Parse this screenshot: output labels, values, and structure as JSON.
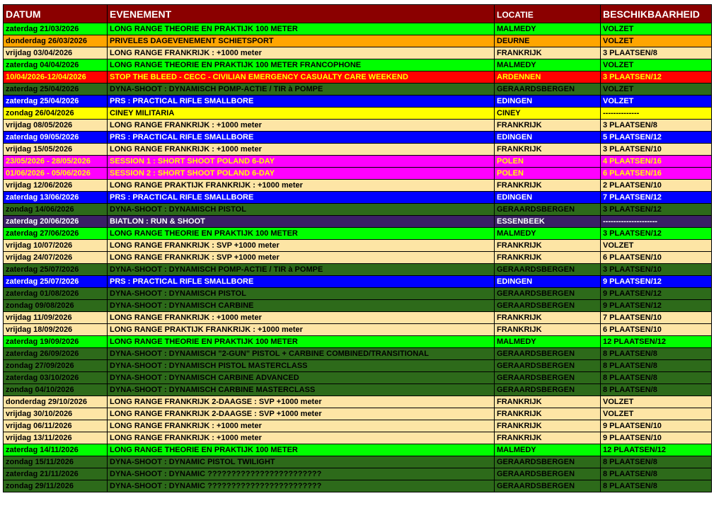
{
  "headers": {
    "datum": "DATUM",
    "evenement": "EVENEMENT",
    "locatie": "LOCATIE",
    "beschikbaarheid": "BESCHIKBAARHEID"
  },
  "colors": {
    "header": "#8b0000",
    "green": "#00ff00",
    "orange": "#ffa500",
    "beige": "#fde5a5",
    "red": "#ff0000",
    "darkgreen": "#2d6a1a",
    "blue": "#0000ff",
    "yellow": "#ffff00",
    "magenta": "#ff00ff",
    "purple": "#3a1f66"
  },
  "rows": [
    {
      "date": "zaterdag 21/03/2026",
      "event": "LONG RANGE THEORIE EN PRAKTIJK 100 METER",
      "location": "MALMEDY",
      "availability": "VOLZET",
      "style": "greenbright"
    },
    {
      "date": "donderdag 26/03/2026",
      "event": "PRIVELES DAGEVENEMENT SCHIETSPORT",
      "location": "DEURNE",
      "availability": "VOLZET",
      "style": "orange"
    },
    {
      "date": "vrijdag 03/04/2026",
      "event": "LONG RANGE FRANKRIJK : +1000 meter",
      "location": "FRANKRIJK",
      "availability": "3 PLAATSEN/8",
      "style": "beige"
    },
    {
      "date": "zaterdag 04/04/2026",
      "event": "LONG RANGE THEORIE EN PRAKTIJK 100 METER FRANCOPHONE",
      "location": "MALMEDY",
      "availability": "VOLZET",
      "style": "greenbright"
    },
    {
      "date": "10/04/2026-12/04/2026",
      "event": "STOP THE BLEED - CECC - CIVILIAN EMERGENCY CASUALTY CARE WEEKEND",
      "location": "ARDENNEN",
      "availability": "3 PLAATSEN/12",
      "style": "red"
    },
    {
      "date": "zaterdag 25/04/2026",
      "event": "DYNA-SHOOT : DYNAMISCH POMP-ACTIE / TIR à POMPE",
      "location": "GERAARDSBERGEN",
      "availability": "VOLZET",
      "style": "darkgreen"
    },
    {
      "date": "zaterdag 25/04/2026",
      "event": "PRS : PRACTICAL RIFLE SMALLBORE",
      "location": "EDINGEN",
      "availability": "VOLZET",
      "style": "blue"
    },
    {
      "date": "zondag 26/04/2026",
      "event": "CINEY MILITARIA",
      "location": "CINEY",
      "availability": "--------------",
      "style": "yellow"
    },
    {
      "date": "vrijdag 08/05/2026",
      "event": "LONG RANGE FRANKRIJK : +1000 meter",
      "location": "FRANKRIJK",
      "availability": "3 PLAATSEN/8",
      "style": "beige"
    },
    {
      "date": "zaterdag 09/05/2026",
      "event": "PRS : PRACTICAL RIFLE SMALLBORE",
      "location": "EDINGEN",
      "availability": "5 PLAATSEN/12",
      "style": "blue"
    },
    {
      "date": "vrijdag 15/05/2026",
      "event": "LONG RANGE FRANKRIJK : +1000 meter",
      "location": "FRANKRIJK",
      "availability": "3 PLAATSEN/10",
      "style": "beige"
    },
    {
      "date": "23/05/2026 - 28/05/2026",
      "event": "SESSION 1 : SHORT SHOOT POLAND 6-DAY",
      "location": "POLEN",
      "availability": "4 PLAATSEN/16",
      "style": "magenta"
    },
    {
      "date": "01/06/2026 - 05/06/2026",
      "event": "SESSION 2 : SHORT SHOOT POLAND 6-DAY",
      "location": "POLEN",
      "availability": "6 PLAATSEN/16",
      "style": "magenta"
    },
    {
      "date": "vrijdag 12/06/2026",
      "event": "LONG RANGE PRAKTIJK FRANKRIJK : +1000 meter",
      "location": "FRANKRIJK",
      "availability": "2 PLAATSEN/10",
      "style": "beige"
    },
    {
      "date": "zaterdag 13/06/2026",
      "event": "PRS : PRACTICAL RIFLE SMALLBORE",
      "location": "EDINGEN",
      "availability": "7 PLAATSEN/12",
      "style": "blue"
    },
    {
      "date": "zondag 14/06/2026",
      "event": "DYNA-SHOOT : DYNAMISCH PISTOL",
      "location": "GERAARDSBERGEN",
      "availability": "3 PLAATSEN/12",
      "style": "darkgreen"
    },
    {
      "date": "zaterdag 20/06/2026",
      "event": "BIATLON : RUN & SHOOT",
      "location": "ESSENBEEK",
      "availability": "---------------------",
      "style": "purple"
    },
    {
      "date": "zaterdag 27/06/2026",
      "event": "LONG RANGE THEORIE EN PRAKTIJK 100 METER",
      "location": "MALMEDY",
      "availability": "3 PLAATSEN/12",
      "style": "greenbright"
    },
    {
      "date": "vrijdag 10/07/2026",
      "event": "LONG RANGE  FRANKRIJK : SVP +1000 meter",
      "location": "FRANKRIJK",
      "availability": "VOLZET",
      "style": "beige"
    },
    {
      "date": "vrijdag 24/07/2026",
      "event": "LONG RANGE FRANKRIJK : SVP +1000 meter",
      "location": "FRANKRIJK",
      "availability": "6 PLAATSEN/10",
      "style": "beige"
    },
    {
      "date": "zaterdag 25/07/2026",
      "event": "DYNA-SHOOT : DYNAMISCH POMP-ACTIE / TIR à POMPE",
      "location": "GERAARDSBERGEN",
      "availability": "3 PLAATSEN/10",
      "style": "darkgreen"
    },
    {
      "date": "zaterdag 25/07/2026",
      "event": "PRS : PRACTICAL RIFLE SMALLBORE",
      "location": "EDINGEN",
      "availability": "9 PLAATSEN/12",
      "style": "blue"
    },
    {
      "date": "zaterdag 01/08/2026",
      "event": "DYNA-SHOOT : DYNAMISCH PISTOL",
      "location": "GERAARDSBERGEN",
      "availability": "9 PLAATSEN/12",
      "style": "darkgreen"
    },
    {
      "date": "zondag 09/08/2026",
      "event": "DYNA-SHOOT : DYNAMISCH CARBINE",
      "location": "GERAARDSBERGEN",
      "availability": "9 PLAATSEN/12",
      "style": "darkgreen"
    },
    {
      "date": "vrijdag 11/09/2026",
      "event": "LONG RANGE FRANKRIJK : +1000 meter",
      "location": "FRANKRIJK",
      "availability": "7 PLAATSEN/10",
      "style": "beige"
    },
    {
      "date": "vrijdag 18/09/2026",
      "event": "LONG RANGE PRAKTIJK FRANKRIJK : +1000 meter",
      "location": "FRANKRIJK",
      "availability": "6 PLAATSEN/10",
      "style": "beige"
    },
    {
      "date": "zaterdag 19/09/2026",
      "event": "LONG RANGE THEORIE EN PRAKTIJK 100 METER",
      "location": "MALMEDY",
      "availability": "12 PLAATSEN/12",
      "style": "greenbright"
    },
    {
      "date": "zaterdag 26/09/2026",
      "event": "DYNA-SHOOT : DYNAMISCH \"2-GUN\" PISTOL + CARBINE COMBINED/TRANSITIONAL",
      "location": "GERAARDSBERGEN",
      "availability": "8 PLAATSEN/8",
      "style": "darkgreen"
    },
    {
      "date": "zondag 27/09/2026",
      "event": "DYNA-SHOOT : DYNAMISCH PISTOL MASTERCLASS",
      "location": "GERAARDSBERGEN",
      "availability": "8 PLAATSEN/8",
      "style": "darkgreen"
    },
    {
      "date": "zaterdag 03/10/2026",
      "event": "DYNA-SHOOT : DYNAMISCH CARBINE ADVANCED",
      "location": "GERAARDSBERGEN",
      "availability": "8 PLAATSEN/8",
      "style": "darkgreen"
    },
    {
      "date": "zondag 04/10/2026",
      "event": "DYNA-SHOOT : DYNAMISCH CARBINE MASTERCLASS",
      "location": "GERAARDSBERGEN",
      "availability": "8 PLAATSEN/8",
      "style": "darkgreen"
    },
    {
      "date": "donderdag 29/10/2026",
      "event": "LONG RANGE FRANKRIJK 2-DAAGSE : SVP +1000 meter",
      "location": "FRANKRIJK",
      "availability": "VOLZET",
      "style": "beige"
    },
    {
      "date": "vrijdag 30/10/2026",
      "event": "LONG RANGE FRANKRIJK 2-DAAGSE : SVP +1000 meter",
      "location": "FRANKRIJK",
      "availability": "VOLZET",
      "style": "beige"
    },
    {
      "date": "vrijdag 06/11/2026",
      "event": "LONG RANGE FRANKRIJK : +1000 meter",
      "location": "FRANKRIJK",
      "availability": "9 PLAATSEN/10",
      "style": "beige"
    },
    {
      "date": "vrijdag 13/11/2026",
      "event": "LONG RANGE FRANKRIJK : +1000 meter",
      "location": "FRANKRIJK",
      "availability": "9 PLAATSEN/10",
      "style": "beige"
    },
    {
      "date": "zaterdag 14/11/2026",
      "event": "LONG RANGE THEORIE EN PRAKTIJK 100 METER",
      "location": "MALMEDY",
      "availability": "12 PLAATSEN/12",
      "style": "greenbright"
    },
    {
      "date": "zondag 15/11/2026",
      "event": "DYNA-SHOOT : DYNAMIC PISTOL TWILIGHT",
      "location": "GERAARDSBERGEN",
      "availability": "8 PLAATSEN/8",
      "style": "darkgreen"
    },
    {
      "date": "zaterdag 21/11/2026",
      "event": "DYNA-SHOOT : DYNAMIC ????????????????????????",
      "location": "GERAARDSBERGEN",
      "availability": "8 PLAATSEN/8",
      "style": "darkgreen"
    },
    {
      "date": "zondag 29/11/2026",
      "event": "DYNA-SHOOT : DYNAMIC ????????????????????????",
      "location": "GERAARDSBERGEN",
      "availability": "8 PLAATSEN/8",
      "style": "darkgreen"
    }
  ]
}
